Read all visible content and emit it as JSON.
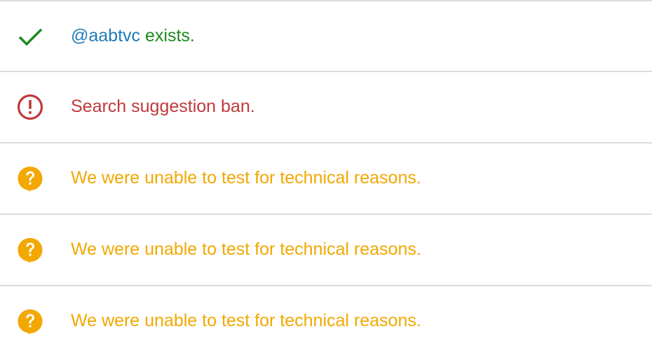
{
  "colors": {
    "success": "#1e8a1e",
    "handle": "#1f7ab8",
    "danger": "#c0393b",
    "warning": "#f2a800",
    "divider": "#dcdcdc"
  },
  "results": [
    {
      "icon": "check-icon",
      "handle": "@aabtvc",
      "message": " exists."
    },
    {
      "icon": "alert-circle-icon",
      "message": "Search suggestion ban."
    },
    {
      "icon": "question-bubble-icon",
      "message": "We were unable to test for technical reasons."
    },
    {
      "icon": "question-bubble-icon",
      "message": "We were unable to test for technical reasons."
    },
    {
      "icon": "question-bubble-icon",
      "message": "We were unable to test for technical reasons."
    }
  ]
}
